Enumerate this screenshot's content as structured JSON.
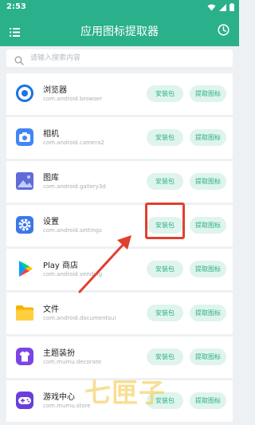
{
  "status_bar": {
    "time": "2:53"
  },
  "app_bar": {
    "title": "应用图标提取器",
    "menu_icon": "list-icon",
    "history_icon": "clock-icon"
  },
  "search": {
    "placeholder": "请输入搜索内容"
  },
  "colors": {
    "primary": "#2ab08b",
    "button_bg": "#dff4ec",
    "highlight": "#e0402f"
  },
  "apps": [
    {
      "name": "浏览器",
      "package": "com.android.browser",
      "install_label": "安装包",
      "extract_label": "提取图标",
      "icon": "browser-icon"
    },
    {
      "name": "相机",
      "package": "com.android.camera2",
      "install_label": "安装包",
      "extract_label": "提取图标",
      "icon": "camera-icon"
    },
    {
      "name": "图库",
      "package": "com.android.gallery3d",
      "install_label": "安装包",
      "extract_label": "提取图标",
      "icon": "gallery-icon"
    },
    {
      "name": "设置",
      "package": "com.android.settings",
      "install_label": "安装包",
      "extract_label": "提取图标",
      "icon": "settings-icon"
    },
    {
      "name": "Play 商店",
      "package": "com.android.vending",
      "install_label": "安装包",
      "extract_label": "提取图标",
      "icon": "play-store-icon"
    },
    {
      "name": "文件",
      "package": "com.android.documentsui",
      "install_label": "安装包",
      "extract_label": "提取图标",
      "icon": "folder-icon"
    },
    {
      "name": "主题装扮",
      "package": "com.mumu.decorate",
      "install_label": "安装包",
      "extract_label": "提取图标",
      "icon": "theme-icon"
    },
    {
      "name": "游戏中心",
      "package": "com.mumu.store",
      "install_label": "安装包",
      "extract_label": "提取图标",
      "icon": "gamepad-icon"
    }
  ],
  "watermark": "七匣子"
}
